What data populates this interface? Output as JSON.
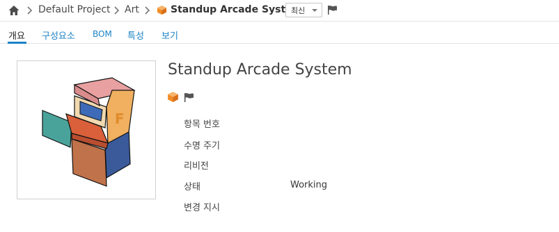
{
  "breadcrumb": {
    "items": [
      "Default Project",
      "Art"
    ],
    "current": "Standup Arcade System"
  },
  "version_selector": {
    "selected": "최신"
  },
  "tabs": [
    {
      "label": "개요",
      "active": true
    },
    {
      "label": "구성요소",
      "active": false
    },
    {
      "label": "BOM",
      "active": false
    },
    {
      "label": "특성",
      "active": false
    },
    {
      "label": "보기",
      "active": false
    }
  ],
  "item": {
    "title": "Standup Arcade System",
    "icon": "orange-cube-icon",
    "flag_icon": "flag-icon"
  },
  "properties": [
    {
      "label": "항목 번호",
      "value": ""
    },
    {
      "label": "수명 주기",
      "value": ""
    },
    {
      "label": "리비전",
      "value": ""
    },
    {
      "label": "상태",
      "value": "Working"
    },
    {
      "label": "변경 지시",
      "value": ""
    }
  ],
  "colors": {
    "link": "#1a83c6",
    "cube_orange": "#f28c28",
    "border": "#e3e3e3"
  }
}
